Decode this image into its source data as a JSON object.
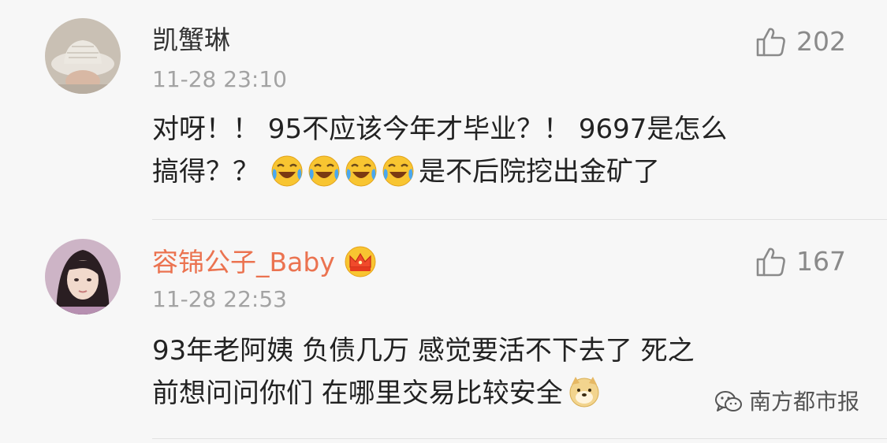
{
  "comments": [
    {
      "username": "凯蟹琳",
      "timestamp": "11-28 23:10",
      "likes": "202",
      "text_line1": "对呀！！ 95不应该今年才毕业？！ 9697是怎么",
      "text_line2": "搞得？？",
      "text_line2_after": "是不后院挖出金矿了",
      "emojis": [
        "laugh-cry-emoji",
        "laugh-cry-emoji",
        "laugh-cry-emoji",
        "laugh-cry-emoji"
      ]
    },
    {
      "username": "容锦公子_Baby",
      "timestamp": "11-28 22:53",
      "likes": "167",
      "badge": "crown-icon",
      "text_line1": "93年老阿姨 负债几万 感觉要活不下去了 死之",
      "text_line2": "前想问问你们 在哪里交易比较安全",
      "emojis": [
        "doge-emoji"
      ]
    }
  ],
  "watermark": {
    "text": "南方都市报",
    "icon": "wechat-icon"
  },
  "colors": {
    "background": "#f7f7f7",
    "vip_name": "#eb7350",
    "timestamp": "#a3a3a3",
    "text": "#222222"
  }
}
